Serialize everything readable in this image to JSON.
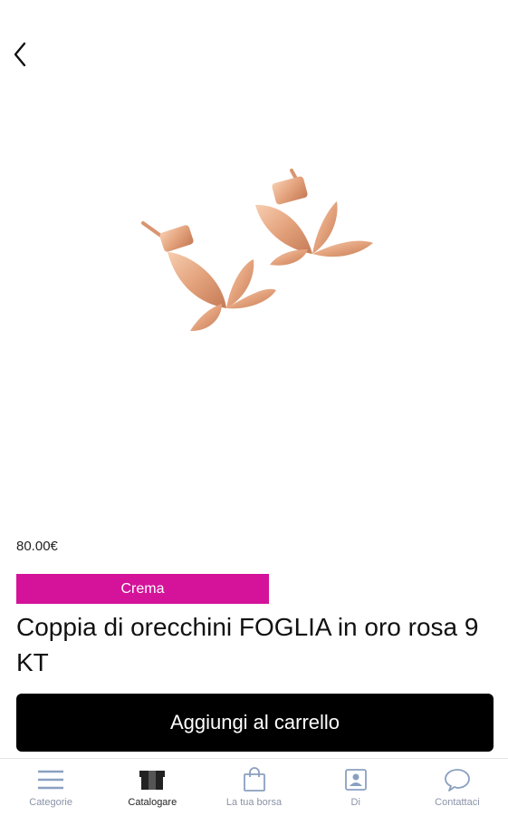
{
  "product": {
    "price": "80.00€",
    "tag": "Crema",
    "title": "Coppia di orecchini FOGLIA in oro rosa 9 KT",
    "image_alt": "rose-gold-leaf-earrings"
  },
  "actions": {
    "add_to_cart": "Aggiungi al carrello"
  },
  "tabbar": {
    "items": [
      {
        "label": "Categorie",
        "icon": "menu-icon"
      },
      {
        "label": "Catalogare",
        "icon": "box-icon"
      },
      {
        "label": "La tua borsa",
        "icon": "bag-icon"
      },
      {
        "label": "Di",
        "icon": "profile-icon"
      },
      {
        "label": "Contattaci",
        "icon": "chat-icon"
      }
    ],
    "active_index": 1
  },
  "colors": {
    "tag_background": "#d4139a",
    "button_background": "#000000",
    "tab_icon": "#8aa0c0",
    "tab_label": "#8a93a6"
  }
}
